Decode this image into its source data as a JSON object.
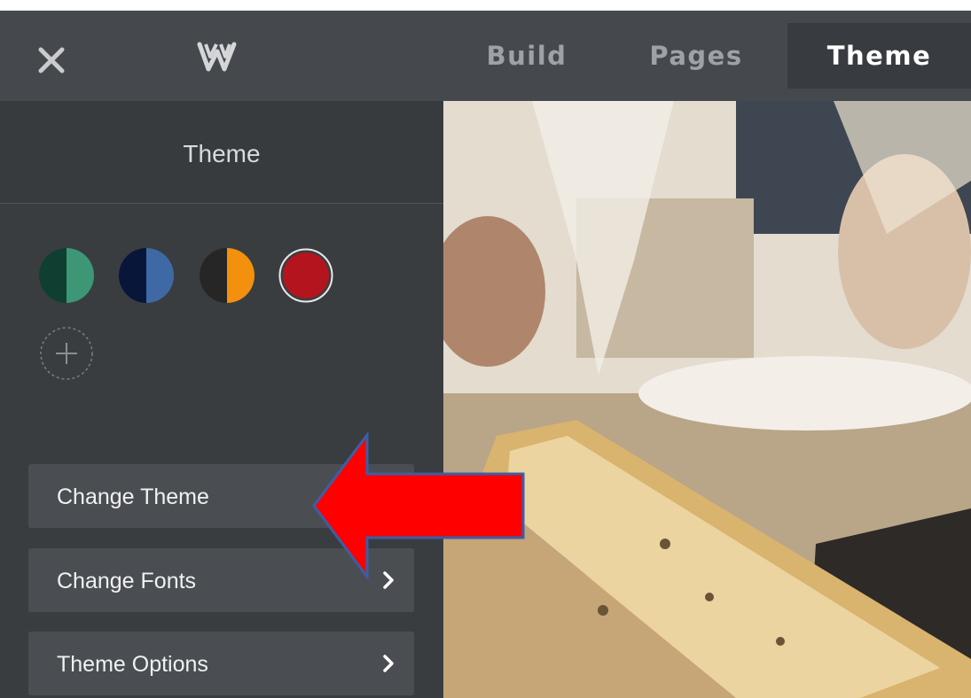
{
  "topbar": {
    "tabs": [
      {
        "label": "Build"
      },
      {
        "label": "Pages"
      },
      {
        "label": "Theme"
      }
    ]
  },
  "sidebar": {
    "title": "Theme",
    "swatches": [
      {
        "name": "green",
        "left": "#0f3f30",
        "right": "#3d9776"
      },
      {
        "name": "blue",
        "left": "#08163a",
        "right": "#3f69a4"
      },
      {
        "name": "orange",
        "left": "#262626",
        "right": "#f3900d"
      },
      {
        "name": "red",
        "color": "#b4141d",
        "selected": true
      }
    ],
    "menu": [
      {
        "label": "Change Theme"
      },
      {
        "label": "Change Fonts"
      },
      {
        "label": "Theme Options"
      }
    ]
  },
  "annotation": {
    "arrow_color": "#ff0000",
    "arrow_outline": "#3a5fa6"
  }
}
